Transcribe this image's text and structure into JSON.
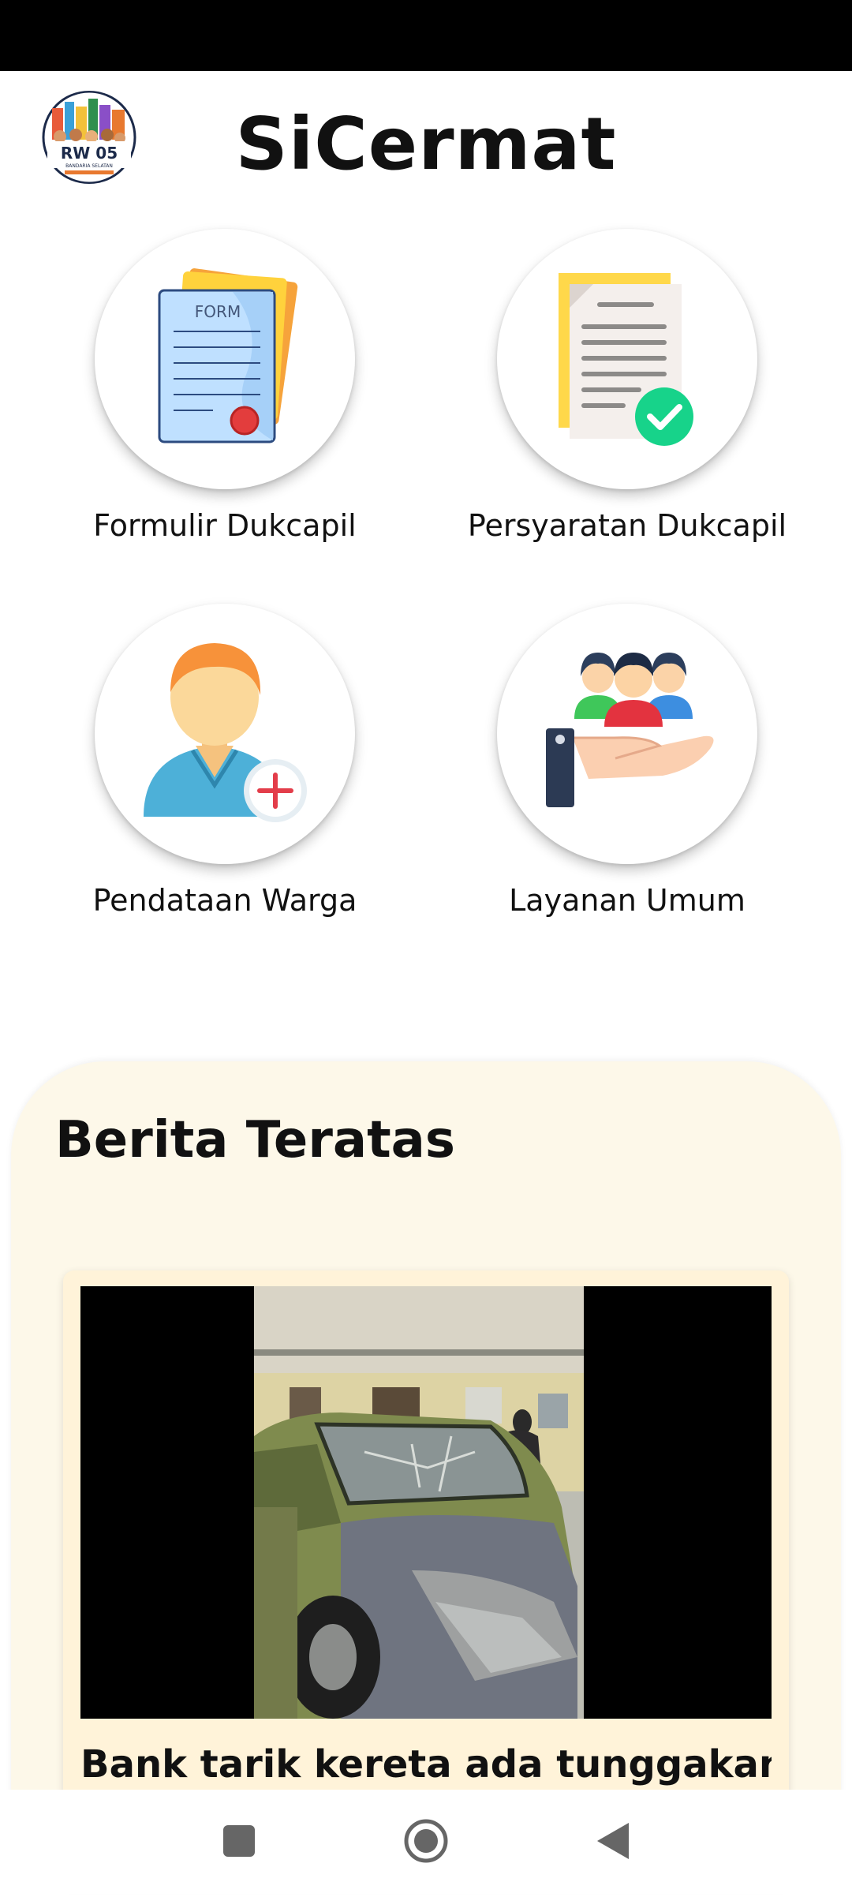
{
  "app": {
    "title": "SiCermat",
    "logo_text": "RW 05",
    "logo_subtext": "BANDARIA SELATAN"
  },
  "menu": [
    {
      "label": "Formulir Dukcapil",
      "icon": "form-document-icon",
      "icon_text": "FORM"
    },
    {
      "label": "Persyaratan Dukcapil",
      "icon": "requirements-checklist-icon"
    },
    {
      "label": "Pendataan Warga",
      "icon": "add-citizen-icon"
    },
    {
      "label": "Layanan Umum",
      "icon": "public-service-icon"
    }
  ],
  "news": {
    "section_title": "Berita Teratas",
    "articles": [
      {
        "headline": "Bank tarik kereta ada tunggakan",
        "media": "video"
      }
    ]
  },
  "nav": {
    "icons": [
      "recents-square-icon",
      "home-circle-icon",
      "back-triangle-icon"
    ]
  },
  "colors": {
    "status_bar": "#000000",
    "news_background": "#fdf8e9",
    "article_background": "#fff3d9",
    "check_green": "#17d38a"
  }
}
